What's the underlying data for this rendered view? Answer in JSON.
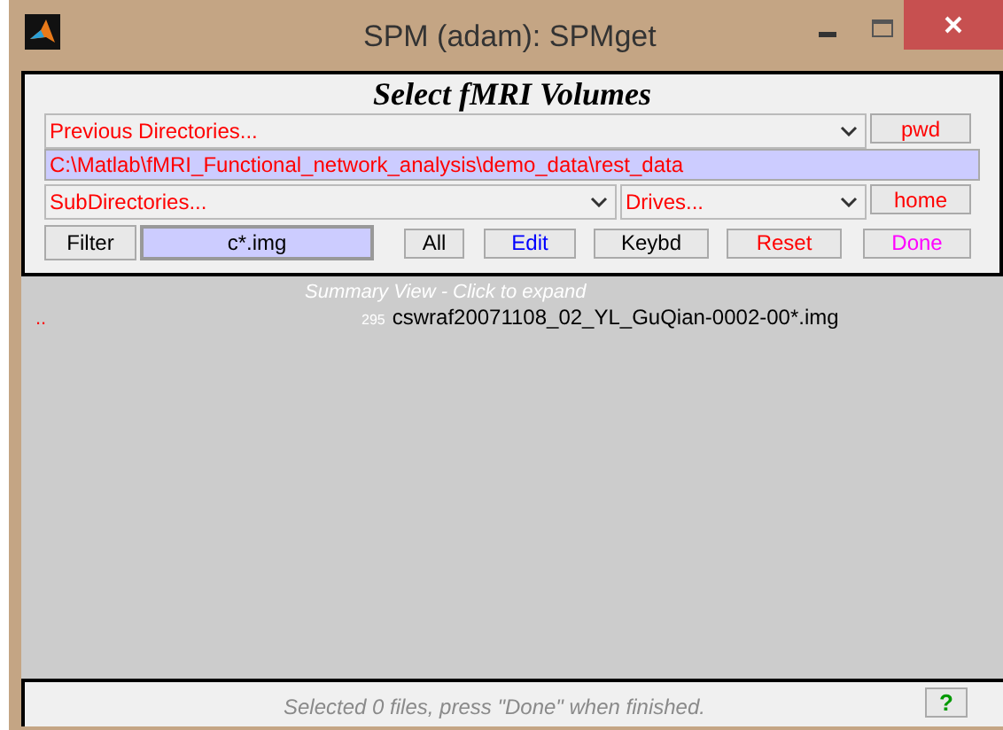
{
  "window": {
    "title": "SPM (adam): SPMget"
  },
  "heading": "Select fMRI Volumes",
  "previous_directories": {
    "value": "Previous Directories..."
  },
  "pwd_button": {
    "label": "pwd",
    "color": "#ff0000"
  },
  "current_directory": "C:\\Matlab\\fMRI_Functional_network_analysis\\demo_data\\rest_data",
  "subdirectories": {
    "value": "SubDirectories..."
  },
  "drives": {
    "value": "Drives..."
  },
  "home_button": {
    "label": "home",
    "color": "#ff0000"
  },
  "filter": {
    "label": "Filter",
    "value": "c*.img"
  },
  "buttons": [
    {
      "label": "All",
      "color": "#000000"
    },
    {
      "label": "Edit",
      "color": "#0000ff"
    },
    {
      "label": "Keybd",
      "color": "#000000"
    },
    {
      "label": "Reset",
      "color": "#ff0000"
    },
    {
      "label": "Done",
      "color": "#ff00ff"
    }
  ],
  "summary_header": "Summary View - Click to expand",
  "parent_entry": "..",
  "files": [
    {
      "count": "295",
      "name": "cswraf20071108_02_YL_GuQian-0002-00*.img"
    }
  ],
  "status": "Selected 0 files, press \"Done\" when finished.",
  "help_button": {
    "label": "?",
    "color": "#009900"
  }
}
